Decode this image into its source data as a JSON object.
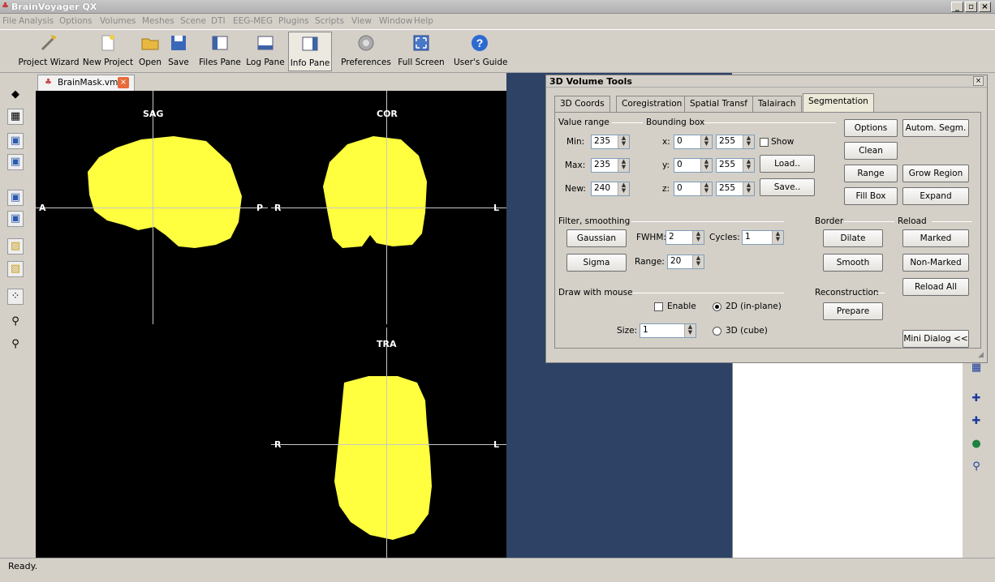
{
  "app": {
    "title": "BrainVoyager QX"
  },
  "menu": [
    "File",
    "Analysis",
    "Options",
    "Volumes",
    "Meshes",
    "Scene",
    "DTI",
    "EEG-MEG",
    "Plugins",
    "Scripts",
    "View",
    "Window",
    "Help"
  ],
  "toolbar": [
    {
      "label": "Project Wizard",
      "icon": "wand-icon"
    },
    {
      "label": "New Project",
      "icon": "new-file-icon"
    },
    {
      "label": "Open",
      "icon": "folder-open-icon"
    },
    {
      "label": "Save",
      "icon": "floppy-icon"
    },
    {
      "label": "Files Pane",
      "icon": "files-pane-icon"
    },
    {
      "label": "Log Pane",
      "icon": "log-pane-icon"
    },
    {
      "label": "Info Pane",
      "icon": "info-pane-icon"
    },
    {
      "label": "Preferences",
      "icon": "gear-icon"
    },
    {
      "label": "Full Screen",
      "icon": "fullscreen-icon"
    },
    {
      "label": "User's Guide",
      "icon": "help-icon"
    }
  ],
  "document": {
    "tab_label": "BrainMask.vmr"
  },
  "views": {
    "sag": {
      "label": "SAG",
      "left": "A",
      "right": "P"
    },
    "cor": {
      "label": "COR",
      "left": "R",
      "right": "L"
    },
    "tra": {
      "label": "TRA",
      "left": "R",
      "right": "L"
    }
  },
  "dialog": {
    "title": "3D Volume Tools",
    "tabs": [
      "3D Coords",
      "Coregistration",
      "Spatial Transf",
      "Talairach",
      "Segmentation"
    ],
    "active_tab": "Segmentation",
    "value_range": {
      "title": "Value range",
      "min_label": "Min:",
      "min": "235",
      "max_label": "Max:",
      "max": "235",
      "new_label": "New:",
      "new": "240"
    },
    "bounding_box": {
      "title": "Bounding box",
      "x_label": "x:",
      "x_from": "0",
      "x_to": "255",
      "y_label": "y:",
      "y_from": "0",
      "y_to": "255",
      "z_label": "z:",
      "z_from": "0",
      "z_to": "255",
      "show_label": "Show",
      "load_label": "Load..",
      "save_label": "Save.."
    },
    "buttons": {
      "options": "Options",
      "autom_segm": "Autom. Segm.",
      "clean": "Clean",
      "range": "Range",
      "grow_region": "Grow Region",
      "fill_box": "Fill Box",
      "expand": "Expand"
    },
    "filter": {
      "title": "Filter, smoothing",
      "gaussian": "Gaussian",
      "fwhm_label": "FWHM:",
      "fwhm": "2",
      "cycles_label": "Cycles:",
      "cycles": "1",
      "sigma": "Sigma",
      "range_label": "Range:",
      "range": "20"
    },
    "border": {
      "title": "Border",
      "dilate": "Dilate",
      "smooth": "Smooth"
    },
    "reload": {
      "title": "Reload",
      "marked": "Marked",
      "non_marked": "Non-Marked",
      "reload_all": "Reload All"
    },
    "draw": {
      "title": "Draw with mouse",
      "enable": "Enable",
      "mode_2d": "2D (in-plane)",
      "mode_3d": "3D (cube)",
      "size_label": "Size:",
      "size": "1"
    },
    "reconstruction": {
      "title": "Reconstruction",
      "prepare": "Prepare"
    },
    "mini_dialog": "Mini Dialog <<"
  },
  "status": "Ready.",
  "colors": {
    "mask": "#ffff40",
    "background": "#2e4266"
  }
}
